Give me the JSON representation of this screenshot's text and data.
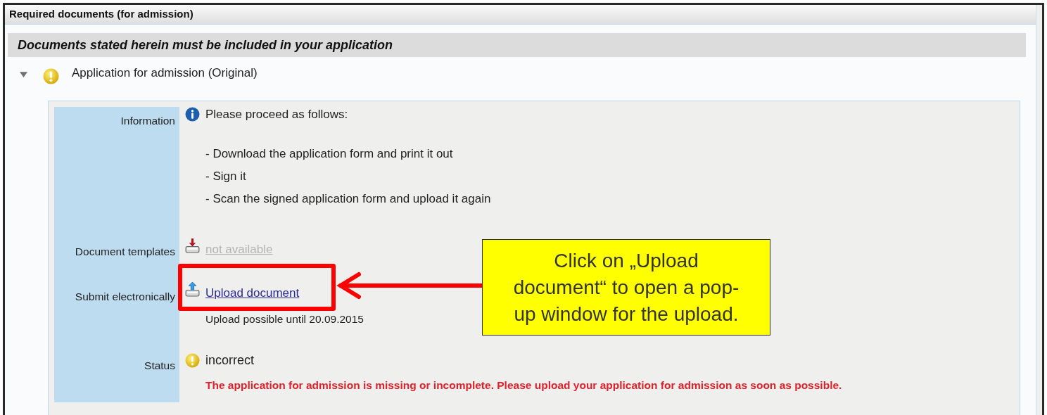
{
  "panel": {
    "title": "Required documents (for admission)",
    "notice": "Documents stated herein must be included in your application",
    "items": [
      {
        "title": "Application for admission (Original)",
        "expanded": true,
        "rows": [
          {
            "kind": "info",
            "label": "Information",
            "text": "Please proceed as follows:",
            "lines": [
              "- Download the application form and print it out",
              "- Sign it",
              "- Scan the signed application form and upload it again"
            ]
          },
          {
            "kind": "download",
            "label": "Document templates",
            "link": "not available",
            "disabled": true
          },
          {
            "kind": "upload",
            "label": "Submit electronically",
            "link": "Upload document",
            "disabled": false,
            "note": "Upload possible until 20.09.2015"
          },
          {
            "kind": "status",
            "label": "Status",
            "value": "incorrect",
            "message": "The application for admission is missing or incomplete. Please upload your application for admission as soon as possible."
          }
        ]
      }
    ]
  },
  "callout": {
    "text": "Click on „Upload document“ to open a pop-up window for the upload."
  }
}
